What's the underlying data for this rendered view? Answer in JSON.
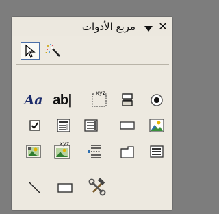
{
  "toolbox": {
    "title": "مربع الأدوات",
    "close_symbol": "✕",
    "tools_row2": [
      {
        "icon": "label-tool-icon",
        "text": "Aa"
      },
      {
        "icon": "textbox-tool-icon",
        "text": "ab|"
      },
      {
        "icon": "option-group-tool-icon",
        "text": "xyz"
      }
    ],
    "tools_row4": [
      {
        "icon": "subform-tool-icon",
        "text": "xyz"
      }
    ]
  },
  "colors": {
    "background": "#7d7d7d",
    "panel": "#ede9e0",
    "selected_border": "#4a6fa8"
  }
}
